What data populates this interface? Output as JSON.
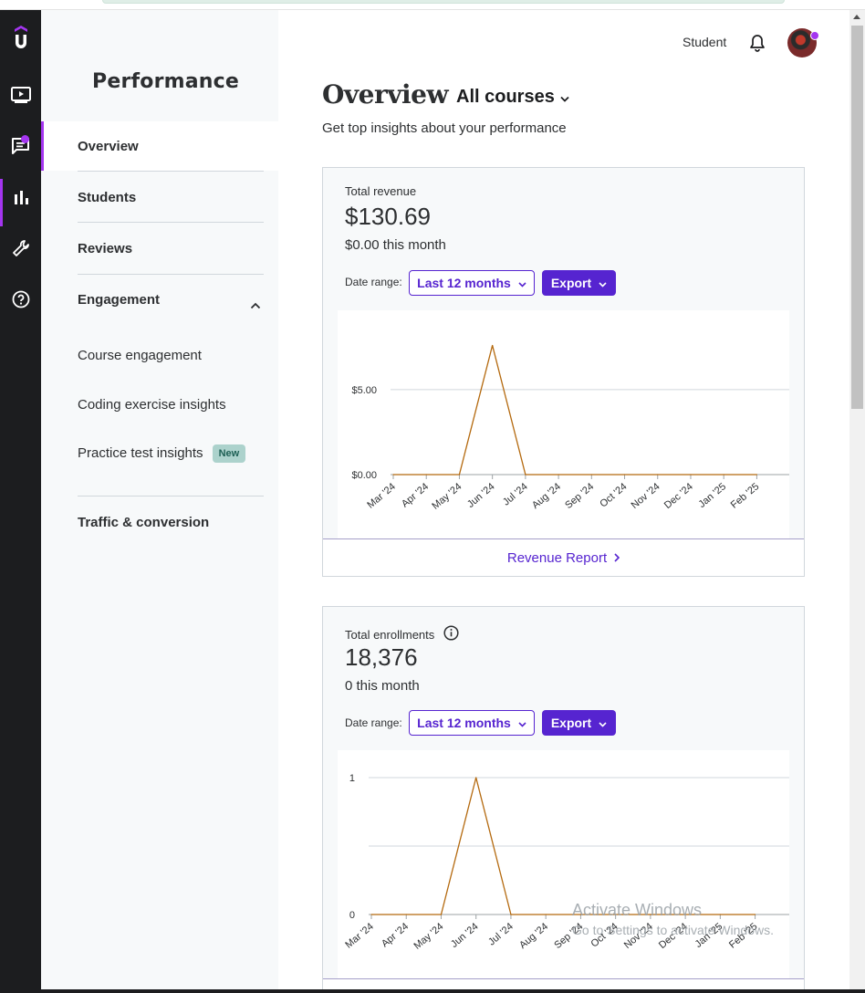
{
  "rail": {
    "items": [
      {
        "icon": "udemy-logo-icon"
      },
      {
        "icon": "video-icon"
      },
      {
        "icon": "messages-icon"
      },
      {
        "icon": "bar-chart-icon"
      },
      {
        "icon": "tools-icon"
      },
      {
        "icon": "help-icon"
      }
    ]
  },
  "sidebar": {
    "title": "Performance",
    "items": [
      {
        "label": "Overview"
      },
      {
        "label": "Students"
      },
      {
        "label": "Reviews"
      },
      {
        "label": "Engagement"
      }
    ],
    "subitems": [
      {
        "label": "Course engagement"
      },
      {
        "label": "Coding exercise insights"
      },
      {
        "label": "Practice test insights",
        "badge": "New"
      }
    ],
    "traffic": "Traffic & conversion"
  },
  "header": {
    "student_label": "Student"
  },
  "main": {
    "title": "Overview",
    "course_select": "All courses",
    "subtitle": "Get top insights about your performance"
  },
  "colors": {
    "accent": "#a435f0",
    "primary": "#5624d0",
    "line": "#b4690e",
    "badge_bg": "#acd2cc"
  },
  "revenue_card": {
    "label": "Total revenue",
    "value": "$130.69",
    "month": "$0.00 this month",
    "date_range_label": "Date range:",
    "range_value": "Last 12 months",
    "export_label": "Export",
    "footer_link": "Revenue Report"
  },
  "enroll_card": {
    "label": "Total enrollments",
    "value": "18,376",
    "month": "0 this month",
    "date_range_label": "Date range:",
    "range_value": "Last 12 months",
    "export_label": "Export"
  },
  "watermark": {
    "line1": "Activate Windows",
    "line2": "Go to Settings to activate Windows."
  },
  "chart_data": [
    {
      "type": "line",
      "x": [
        "Mar '24",
        "Apr '24",
        "May '24",
        "Jun '24",
        "Jul '24",
        "Aug '24",
        "Sep '24",
        "Oct '24",
        "Nov '24",
        "Dec '24",
        "Jan '25",
        "Feb '25"
      ],
      "series": [
        {
          "values": [
            0,
            0,
            0,
            7.6,
            0,
            0,
            0,
            0,
            0,
            0,
            0,
            0
          ]
        }
      ],
      "yticks": [
        "$0.00",
        "$5.00"
      ],
      "ylim": [
        0,
        8.0
      ],
      "grid": true
    },
    {
      "type": "line",
      "x": [
        "Mar '24",
        "Apr '24",
        "May '24",
        "Jun '24",
        "Jul '24",
        "Aug '24",
        "Sep '24",
        "Oct '24",
        "Nov '24",
        "Dec '24",
        "Jan '25",
        "Feb '25"
      ],
      "series": [
        {
          "values": [
            0,
            0,
            0,
            1,
            0,
            0,
            0,
            0,
            0,
            0,
            0,
            0
          ]
        }
      ],
      "yticks": [
        "0",
        "1"
      ],
      "ylim": [
        0,
        1.0
      ],
      "grid": true
    }
  ]
}
